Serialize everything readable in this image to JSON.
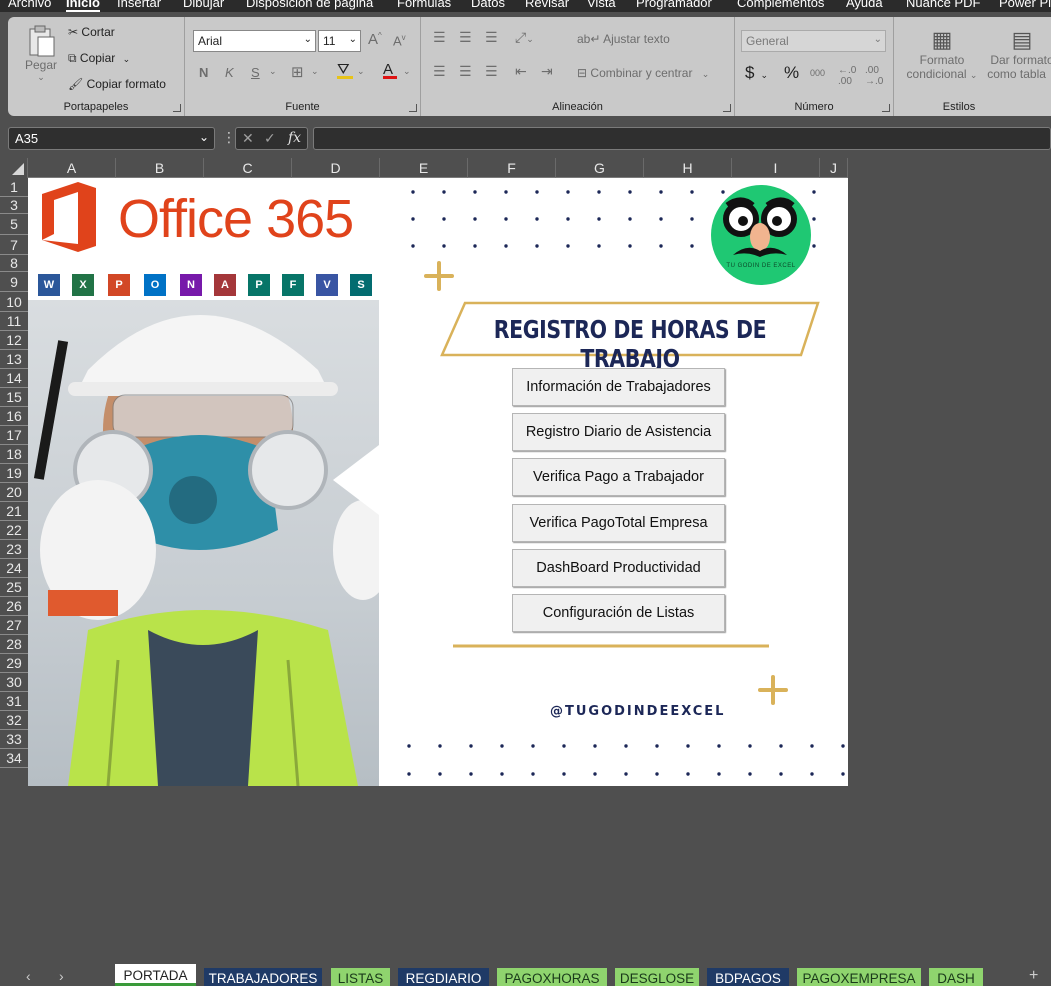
{
  "menu": {
    "items": [
      "Archivo",
      "Inicio",
      "Insertar",
      "Dibujar",
      "Disposición de página",
      "Fórmulas",
      "Datos",
      "Revisar",
      "Vista",
      "Programador",
      "Complementos",
      "Ayuda",
      "Nuance PDF",
      "Power Pi"
    ]
  },
  "ribbon": {
    "clipboard": {
      "paste": "Pegar",
      "cut": "Cortar",
      "copy": "Copiar",
      "format_painter": "Copiar formato",
      "label": "Portapapeles"
    },
    "font": {
      "name": "Arial",
      "size": "11",
      "bold": "N",
      "italic": "K",
      "underline": "S",
      "label": "Fuente"
    },
    "alignment": {
      "wrap": "Ajustar texto",
      "merge": "Combinar y centrar",
      "label": "Alineación"
    },
    "number": {
      "format": "General",
      "currency": "$",
      "percent": "%",
      "thousands": "000",
      "label": "Número"
    },
    "styles": {
      "cond_format_1": "Formato",
      "cond_format_2": "condicional",
      "table_format_1": "Dar formato",
      "table_format_2": "como tabla",
      "label": "Estilos"
    }
  },
  "formula_bar": {
    "name_box": "A35",
    "fx": "fx",
    "value": ""
  },
  "columns": [
    "A",
    "B",
    "C",
    "D",
    "E",
    "F",
    "G",
    "H",
    "I",
    "J"
  ],
  "rows": [
    "1",
    "3",
    "5",
    "7",
    "8",
    "9",
    "10",
    "11",
    "12",
    "13",
    "14",
    "15",
    "16",
    "17",
    "18",
    "19",
    "20",
    "21",
    "22",
    "23",
    "24",
    "25",
    "26",
    "27",
    "28",
    "29",
    "30",
    "31",
    "32",
    "33",
    "34"
  ],
  "cover": {
    "brand": "Office 365",
    "app_icons": [
      "W",
      "X",
      "P",
      "O",
      "N",
      "A",
      "P",
      "F",
      "V",
      "S"
    ],
    "title": "REGISTRO DE HORAS DE TRABAJO",
    "buttons": [
      "Información de Trabajadores",
      "Registro Diario de Asistencia",
      "Verifica Pago a Trabajador",
      "Verifica PagoTotal Empresa",
      "DashBoard Productividad",
      "Configuración de Listas"
    ],
    "handle": "@TUGODINDEEXCEL",
    "logo_caption": "TU GODIN DE EXCEL"
  },
  "sheet_tabs": [
    {
      "label": "PORTADA",
      "style": "active"
    },
    {
      "label": "TRABAJADORES",
      "style": "blue"
    },
    {
      "label": "LISTAS",
      "style": "green"
    },
    {
      "label": "REGDIARIO",
      "style": "blue"
    },
    {
      "label": "PAGOXHORAS",
      "style": "green"
    },
    {
      "label": "DESGLOSE",
      "style": "green"
    },
    {
      "label": "BDPAGOS",
      "style": "blue"
    },
    {
      "label": "PAGOXEMPRESA",
      "style": "green"
    },
    {
      "label": "DASH",
      "style": "green"
    }
  ],
  "colors": {
    "brand_red": "#e0431b",
    "navy": "#1c2757",
    "gold": "#d9b25a",
    "logo_green": "#1fc873"
  }
}
